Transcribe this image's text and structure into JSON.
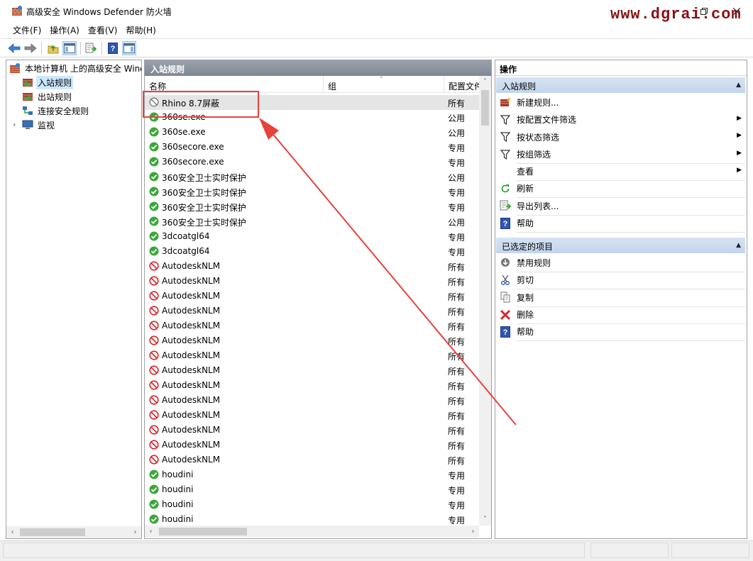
{
  "window": {
    "title": "高级安全 Windows Defender 防火墙",
    "watermark": "www.dgrai.com"
  },
  "menu": [
    "文件(F)",
    "操作(A)",
    "查看(V)",
    "帮助(H)"
  ],
  "toolbar": {
    "icons": [
      "back-arrow-icon",
      "forward-arrow-icon",
      "up-folder-icon",
      "show-hide-tree-icon",
      "export-list-icon",
      "help-icon",
      "show-hide-action-pane-icon"
    ]
  },
  "tree": {
    "root": "本地计算机 上的高级安全 Wind",
    "items": [
      {
        "label": "入站规则",
        "icon": "inbound-rules-icon",
        "selected": true
      },
      {
        "label": "出站规则",
        "icon": "outbound-rules-icon",
        "selected": false
      },
      {
        "label": "连接安全规则",
        "icon": "connection-security-icon",
        "selected": false
      },
      {
        "label": "监视",
        "icon": "monitor-icon",
        "selected": false
      }
    ]
  },
  "list": {
    "header": "入站规则",
    "columns": {
      "name": "名称",
      "group": "组",
      "profile": "配置文件"
    },
    "rows": [
      {
        "name": "Rhino 8.7屏蔽",
        "status": "disabled",
        "profile": "所有"
      },
      {
        "name": "360se.exe",
        "status": "allow",
        "profile": "公用"
      },
      {
        "name": "360se.exe",
        "status": "allow",
        "profile": "公用"
      },
      {
        "name": "360secore.exe",
        "status": "allow",
        "profile": "专用"
      },
      {
        "name": "360secore.exe",
        "status": "allow",
        "profile": "专用"
      },
      {
        "name": "360安全卫士实时保护",
        "status": "allow",
        "profile": "公用"
      },
      {
        "name": "360安全卫士实时保护",
        "status": "allow",
        "profile": "专用"
      },
      {
        "name": "360安全卫士实时保护",
        "status": "allow",
        "profile": "专用"
      },
      {
        "name": "360安全卫士实时保护",
        "status": "allow",
        "profile": "公用"
      },
      {
        "name": "3dcoatgl64",
        "status": "allow",
        "profile": "专用"
      },
      {
        "name": "3dcoatgl64",
        "status": "allow",
        "profile": "专用"
      },
      {
        "name": "AutodeskNLM",
        "status": "block",
        "profile": "所有"
      },
      {
        "name": "AutodeskNLM",
        "status": "block",
        "profile": "所有"
      },
      {
        "name": "AutodeskNLM",
        "status": "block",
        "profile": "所有"
      },
      {
        "name": "AutodeskNLM",
        "status": "block",
        "profile": "所有"
      },
      {
        "name": "AutodeskNLM",
        "status": "block",
        "profile": "所有"
      },
      {
        "name": "AutodeskNLM",
        "status": "block",
        "profile": "所有"
      },
      {
        "name": "AutodeskNLM",
        "status": "block",
        "profile": "所有"
      },
      {
        "name": "AutodeskNLM",
        "status": "block",
        "profile": "所有"
      },
      {
        "name": "AutodeskNLM",
        "status": "block",
        "profile": "所有"
      },
      {
        "name": "AutodeskNLM",
        "status": "block",
        "profile": "所有"
      },
      {
        "name": "AutodeskNLM",
        "status": "block",
        "profile": "所有"
      },
      {
        "name": "AutodeskNLM",
        "status": "block",
        "profile": "所有"
      },
      {
        "name": "AutodeskNLM",
        "status": "block",
        "profile": "所有"
      },
      {
        "name": "AutodeskNLM",
        "status": "block",
        "profile": "所有"
      },
      {
        "name": "houdini",
        "status": "allow",
        "profile": "专用"
      },
      {
        "name": "houdini",
        "status": "allow",
        "profile": "专用"
      },
      {
        "name": "houdini",
        "status": "allow",
        "profile": "专用"
      },
      {
        "name": "houdini",
        "status": "allow",
        "profile": "专用"
      }
    ]
  },
  "actions": {
    "title": "操作",
    "section1": {
      "label": "入站规则",
      "items": [
        {
          "label": "新建规则...",
          "icon": "new-rule-icon",
          "submenu": false
        },
        {
          "label": "按配置文件筛选",
          "icon": "filter-icon",
          "submenu": true
        },
        {
          "label": "按状态筛选",
          "icon": "filter-icon",
          "submenu": true
        },
        {
          "label": "按组筛选",
          "icon": "filter-icon",
          "submenu": true
        },
        {
          "label": "查看",
          "icon": "",
          "submenu": true
        },
        {
          "label": "刷新",
          "icon": "refresh-icon",
          "submenu": false
        },
        {
          "label": "导出列表...",
          "icon": "export-list-icon",
          "submenu": false
        },
        {
          "label": "帮助",
          "icon": "help-icon",
          "submenu": false
        }
      ]
    },
    "section2": {
      "label": "已选定的项目",
      "items": [
        {
          "label": "禁用规则",
          "icon": "disable-rule-icon"
        },
        {
          "label": "剪切",
          "icon": "cut-icon"
        },
        {
          "label": "复制",
          "icon": "copy-icon"
        },
        {
          "label": "删除",
          "icon": "delete-icon"
        },
        {
          "label": "帮助",
          "icon": "help-icon"
        }
      ]
    }
  },
  "colors": {
    "accent_highlight": "#e8423c",
    "section_header": "#c2d4ec",
    "pane_header": "#8a929d",
    "allow_green": "#3aa83a",
    "block_red": "#d8282a",
    "watermark": "#8b0f14"
  }
}
